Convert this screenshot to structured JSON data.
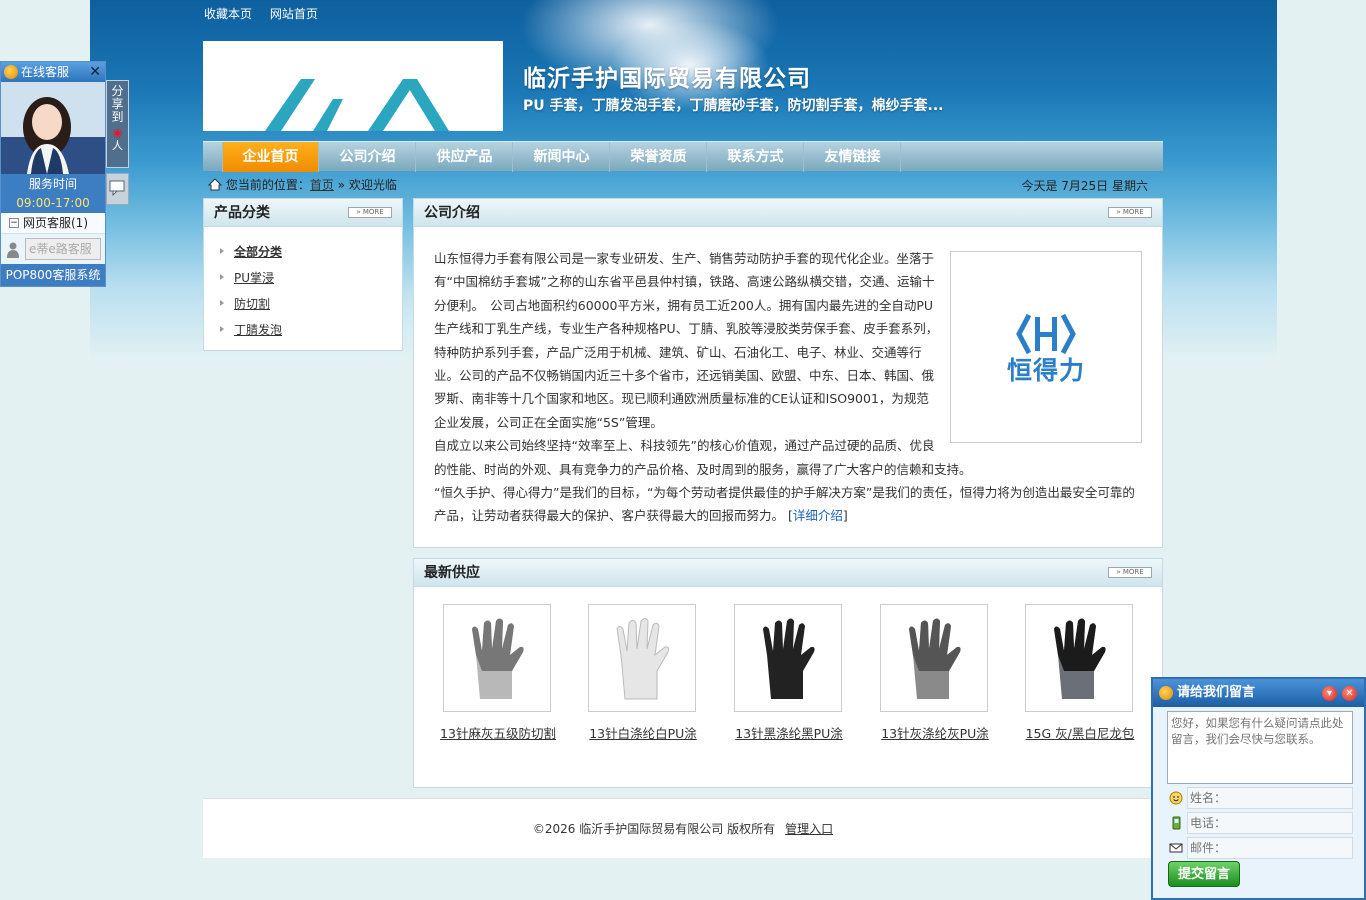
{
  "toplinks": [
    "收藏本页",
    "网站首页"
  ],
  "header": {
    "company_name": "临沂手护国际贸易有限公司",
    "subtitle": "PU 手套，丁腈发泡手套，丁腈磨砂手套，防切割手套，棉纱手套..."
  },
  "nav": [
    "企业首页",
    "公司介绍",
    "供应产品",
    "新闻中心",
    "荣誉资质",
    "联系方式",
    "友情链接"
  ],
  "breadcrumb": {
    "prefix": "您当前的位置：",
    "home": "首页",
    "sep": " » ",
    "current": "欢迎光临"
  },
  "today": "今天是 7月25日 星期六",
  "more_label": "» MORE",
  "sidebar": {
    "title": "产品分类",
    "items": [
      "全部分类",
      "PU掌浸",
      "防切割",
      "丁腈发泡"
    ]
  },
  "intro": {
    "title": "公司介绍",
    "p1": "山东恒得力手套有限公司是一家专业研发、生产、销售劳动防护手套的现代化企业。坐落于有“中国棉纺手套城”之称的山东省平邑县仲村镇，铁路、高速公路纵横交错，交通、运输十分便利。　公司占地面积约60000平方米，拥有员工近200人。拥有国内最先进的全自动PU生产线和丁乳生产线，专业生产各种规格PU、丁腈、乳胶等浸胶类劳保手套、皮手套系列，特种防护系列手套，产品广泛用于机械、建筑、矿山、石油化工、电子、林业、交通等行业。公司的产品不仅畅销国内近三十多个省市，还远销美国、欧盟、中东、日本、韩国、俄罗斯、南非等十几个国家和地区。现已顺利通欧洲质量标准的CE认证和ISO9001，为规范企业发展，公司正在全面实施“5S”管理。",
    "p2": "自成立以来公司始终坚持“效率至上、科技领先”的核心价值观，通过产品过硬的品质、优良的性能、时尚的外观、具有竞争力的产品价格、及时周到的服务，赢得了广大客户的信赖和支持。",
    "p3": "“恒久手护、得心得力”是我们的目标，“为每个劳动者提供最佳的护手解决方案”是我们的责任，恒得力将为创造出最安全可靠的产品，让劳动者获得最大的保护、客户获得最大的回报而努力。",
    "more_link": "详细介绍",
    "logo_text": "恒得力"
  },
  "products": {
    "title": "最新供应",
    "items": [
      {
        "name": "13针麻灰五级防切割"
      },
      {
        "name": "13针白涤纶白PU涂"
      },
      {
        "name": "13针黑涤纶黑PU涂"
      },
      {
        "name": "13针灰涤纶灰PU涂"
      },
      {
        "name": "15G 灰/黑白尼龙包"
      }
    ]
  },
  "footer": {
    "copyright": "©2026 临沂手护国际贸易有限公司 版权所有",
    "admin": "管理入口"
  },
  "kefu": {
    "title": "在线客服",
    "time_label": "服务时间",
    "time": "09:00-17:00",
    "group": "网页客服(1)",
    "member": "e蒂e路客服",
    "system": "POP800客服系统",
    "share": "分享到"
  },
  "message": {
    "title": "请给我们留言",
    "placeholder": "您好，如果您有什么疑问请点此处留言，我们会尽快与您联系。",
    "name": "姓名：",
    "phone": "电话：",
    "email": "邮件：",
    "submit": "提交留言"
  },
  "colors": {
    "nav_active": "#f39a00",
    "link": "#1c62b5",
    "brand": "#2d6fb0"
  }
}
